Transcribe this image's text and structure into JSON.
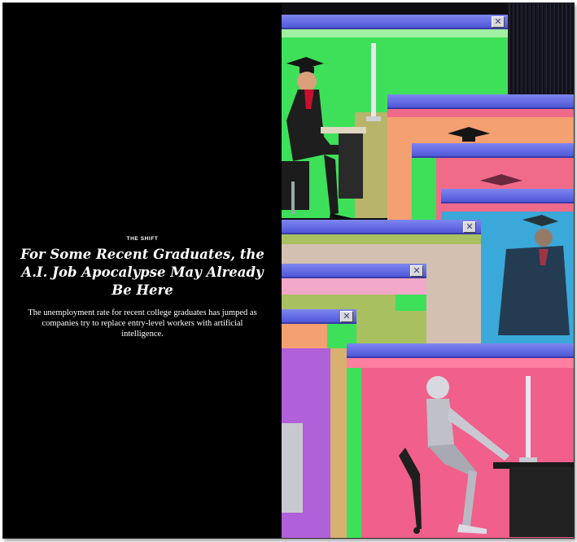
{
  "article": {
    "kicker": "THE SHIFT",
    "headline": "For Some Recent Graduates, the A.I. Job Apocalypse May Already Be Here",
    "dek": "The unemployment rate for recent college graduates has jumped as companies try to replace entry-level workers with artificial intelligence."
  },
  "illustration": {
    "window_close_glyph": "✕",
    "accent_colors": {
      "titlebar": "#6a72e8",
      "green": "#3ee05a",
      "pink": "#f06a8a",
      "orange": "#f5a070",
      "blue": "#3aa8d8"
    }
  }
}
